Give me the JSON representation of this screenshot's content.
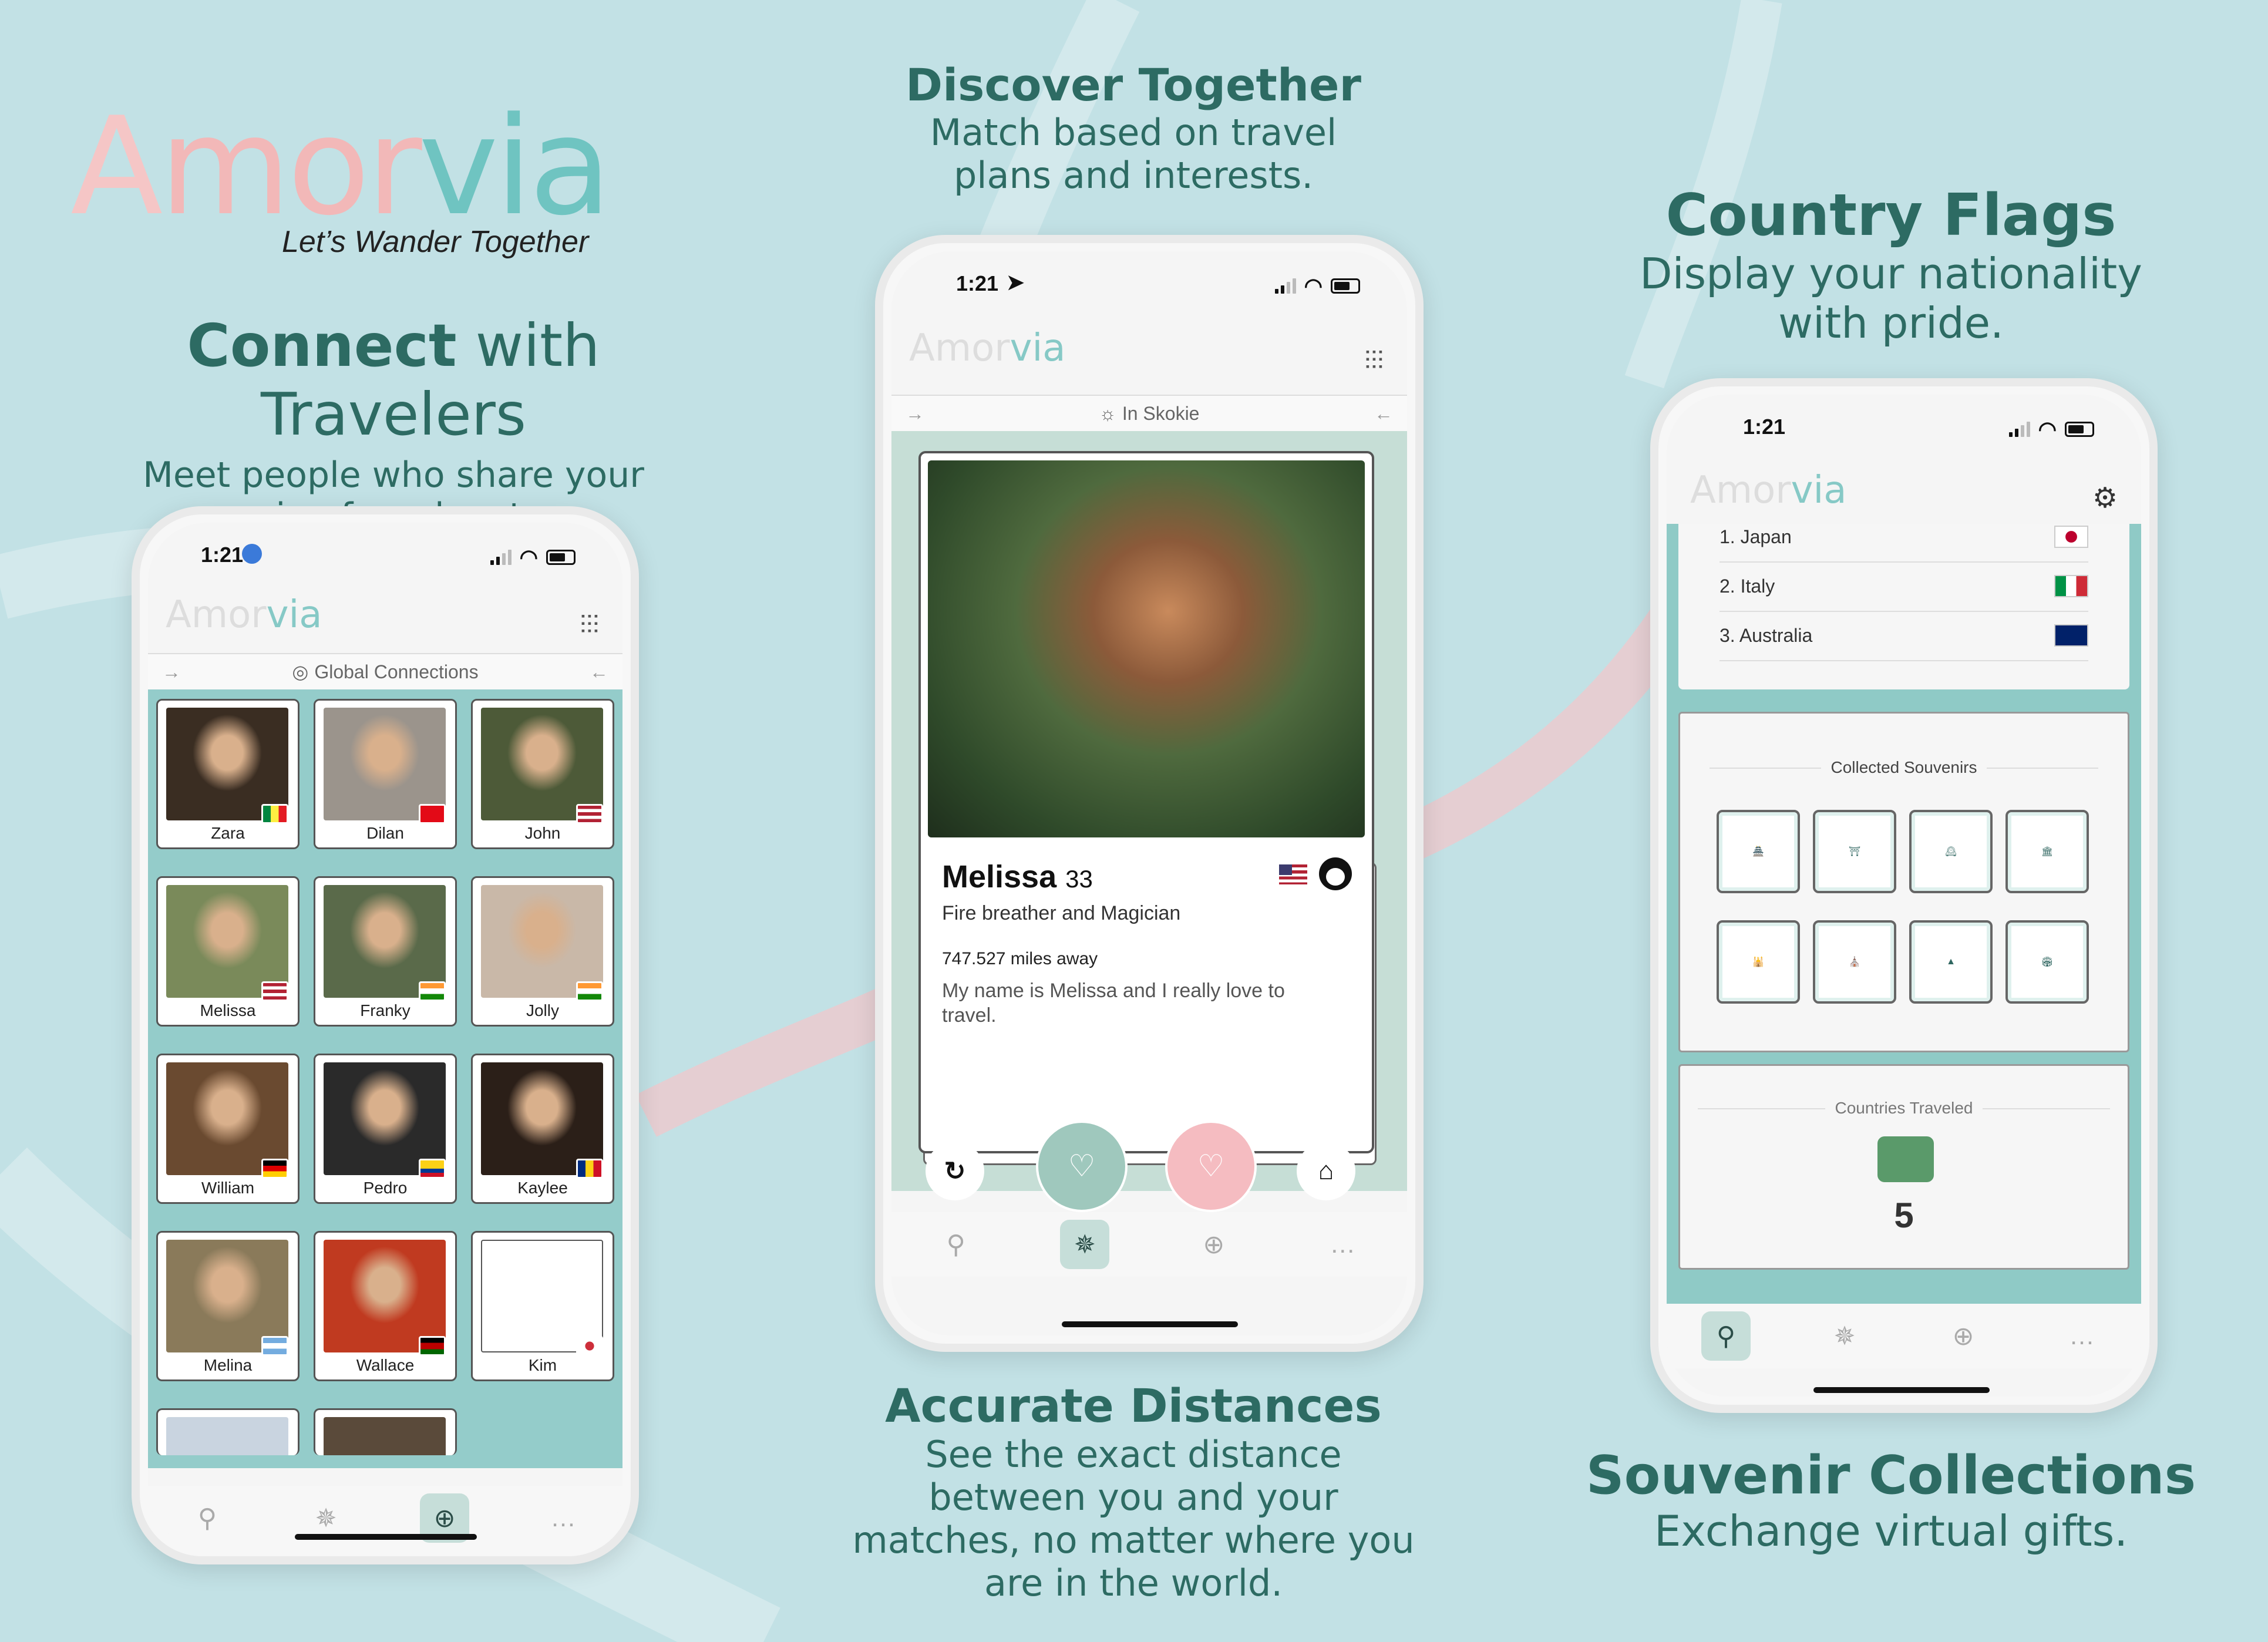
{
  "brand": {
    "logo_a": "A",
    "logo_mor": "mor",
    "logo_via": "via",
    "tagline": "Let’s Wander Together"
  },
  "panel1": {
    "title_bold": "Connect",
    "title_rest": " with Travelers",
    "subtitle_1": "Meet people who share your",
    "subtitle_2": "passion for adventure."
  },
  "panel2": {
    "title": "Discover Together",
    "subtitle_1": "Match based on travel",
    "subtitle_2": "plans and interests."
  },
  "panel3": {
    "title": "Country Flags",
    "subtitle_1": "Display your nationality",
    "subtitle_2": "with pride."
  },
  "panel4": {
    "title": "Accurate Distances",
    "subtitle_1": "See the exact distance",
    "subtitle_2": "between you and your",
    "subtitle_3": "matches, no matter where you",
    "subtitle_4": "are in the world."
  },
  "panel5": {
    "title": "Souvenir Collections",
    "subtitle": "Exchange virtual gifts."
  },
  "phone1": {
    "time": "1:21",
    "logo_a": "A",
    "logo_mor": "mor",
    "logo_via": "via",
    "subbar_label": "Global Connections",
    "profiles": [
      {
        "name": "Zara"
      },
      {
        "name": "Dilan"
      },
      {
        "name": "John"
      },
      {
        "name": "Melissa"
      },
      {
        "name": "Franky"
      },
      {
        "name": "Jolly"
      },
      {
        "name": "William"
      },
      {
        "name": "Pedro"
      },
      {
        "name": "Kaylee"
      },
      {
        "name": "Melina"
      },
      {
        "name": "Wallace"
      },
      {
        "name": "Kim"
      }
    ]
  },
  "phone2": {
    "time": "1:21",
    "logo_a": "A",
    "logo_mor": "mor",
    "logo_via": "via",
    "subbar_label": "In Skokie",
    "card": {
      "name": "Melissa",
      "age": "33",
      "tagline": "Fire breather and Magician",
      "distance": "747.527 miles away",
      "bio_1": "My name is Melissa and I really love to",
      "bio_2": "travel."
    }
  },
  "phone3": {
    "time": "1:21",
    "logo_a": "A",
    "logo_mor": "mor",
    "logo_via": "via",
    "countries": [
      {
        "label": "1. Japan",
        "flag": "japan"
      },
      {
        "label": "2. Italy",
        "flag": "italy"
      },
      {
        "label": "3. Australia",
        "flag": "australia"
      }
    ],
    "souvenirs_title": "Collected Souvenirs",
    "countries_title": "Countries Traveled",
    "countries_count": "5"
  },
  "colors": {
    "background": "#c2e1e5",
    "heading": "#2d6b63",
    "accent_teal": "#6fc4c1",
    "accent_pink": "#f5bcc1",
    "grid_bg": "#94ccca"
  }
}
